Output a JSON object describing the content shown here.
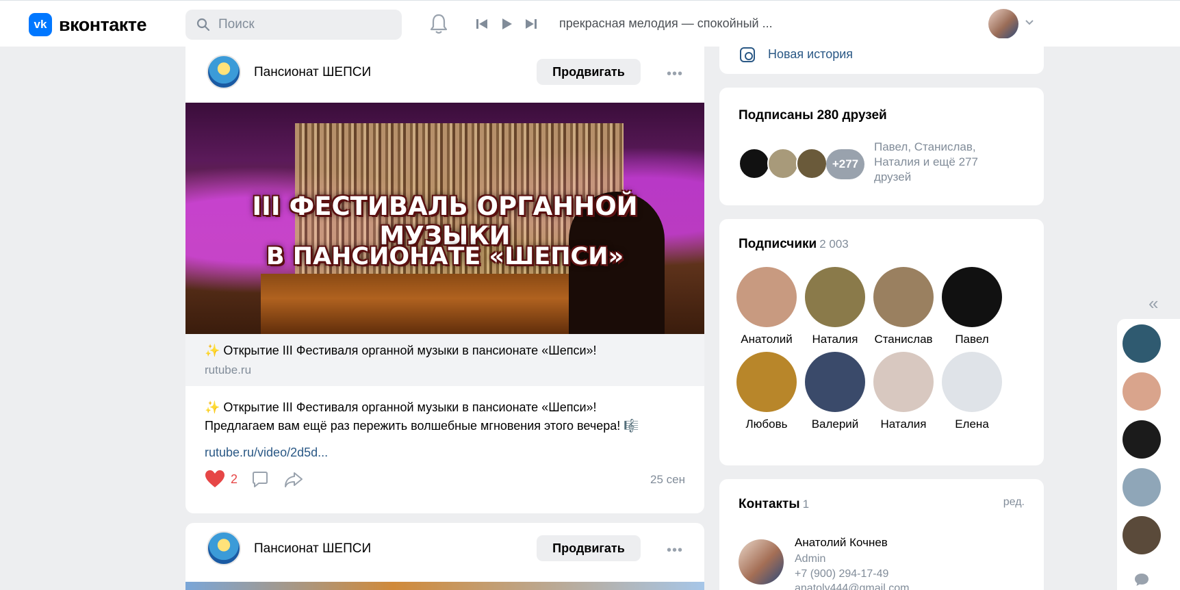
{
  "header": {
    "logo_text": "вконтакте",
    "logo_mark": "vk",
    "search_placeholder": "Поиск",
    "now_playing": "прекрасная мелодия — спокойный ...",
    "icons": [
      "search-icon",
      "bell-icon",
      "previous-icon",
      "play-icon",
      "next-icon",
      "chevron-down-icon"
    ]
  },
  "post1": {
    "group_name": "Пансионат ШЕПСИ",
    "promote_label": "Продвигать",
    "more_label": "•••",
    "banner_line1": "III ФЕСТИВАЛЬ ОРГАННОЙ МУЗЫКИ",
    "banner_line2": "В ПАНСИОНАТЕ «ШЕПСИ»",
    "snippet_title": "✨ Открытие III Фестиваля органной музыки в пансионате «Шепси»!",
    "snippet_source": "rutube.ru",
    "text_line1": "✨ Открытие III Фестиваля органной музыки в пансионате «Шепси»!",
    "text_line2": "Предлагаем вам ещё раз пережить волшебные мгновения этого вечера! 🎼",
    "link": "rutube.ru/video/2d5d...",
    "likes": "2",
    "date": "25 сен"
  },
  "post2": {
    "group_name": "Пансионат ШЕПСИ",
    "promote_label": "Продвигать",
    "more_label": "•••"
  },
  "story": {
    "label": "Новая история"
  },
  "friends": {
    "title": "Подписаны 280 друзей",
    "more_badge": "+277",
    "summary": "Павел, Станислав, Наталия и ещё 277 друзей"
  },
  "subscribers": {
    "title": "Подписчики",
    "count": "2 003",
    "people": [
      {
        "name": "Анатолий",
        "color": "#c89a80"
      },
      {
        "name": "Наталия",
        "color": "#8a7a4a"
      },
      {
        "name": "Станислав",
        "color": "#9a8060"
      },
      {
        "name": "Павел",
        "color": "#111111"
      },
      {
        "name": "Любовь",
        "color": "#b8862a"
      },
      {
        "name": "Валерий",
        "color": "#3a4a6a"
      },
      {
        "name": "Наталия",
        "color": "#d8c8c0"
      },
      {
        "name": "Елена",
        "color": "#dfe3e8"
      }
    ]
  },
  "contacts": {
    "title": "Контакты",
    "count": "1",
    "edit_label": "ред.",
    "name": "Анатолий Кочнев",
    "role": "Admin",
    "phone": "+7 (900) 294-17-49",
    "email": "anatoly444@gmail.com"
  },
  "side": {
    "collapse_label": "«",
    "chats": [
      "#2f5a70",
      "#d9a48c",
      "#1b1b1b",
      "#8fa6b8",
      "#5a4a3a"
    ]
  }
}
